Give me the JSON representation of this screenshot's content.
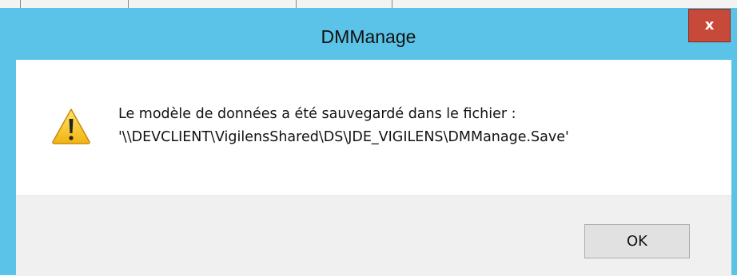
{
  "dialog": {
    "title": "DMManage",
    "close_label": "x",
    "icon": "warning-icon",
    "message_line1": "Le modèle de données a été sauvegardé dans le fichier :",
    "message_line2": "'\\\\DEVCLIENT\\VigilensShared\\DS\\JDE_VIGILENS\\DMManage.Save'",
    "ok_label": "OK"
  },
  "colors": {
    "titlebar": "#5bc3e7",
    "close_button": "#c7493a",
    "button_bar": "#f0f0f0",
    "warning_fill": "#f5c21b"
  }
}
